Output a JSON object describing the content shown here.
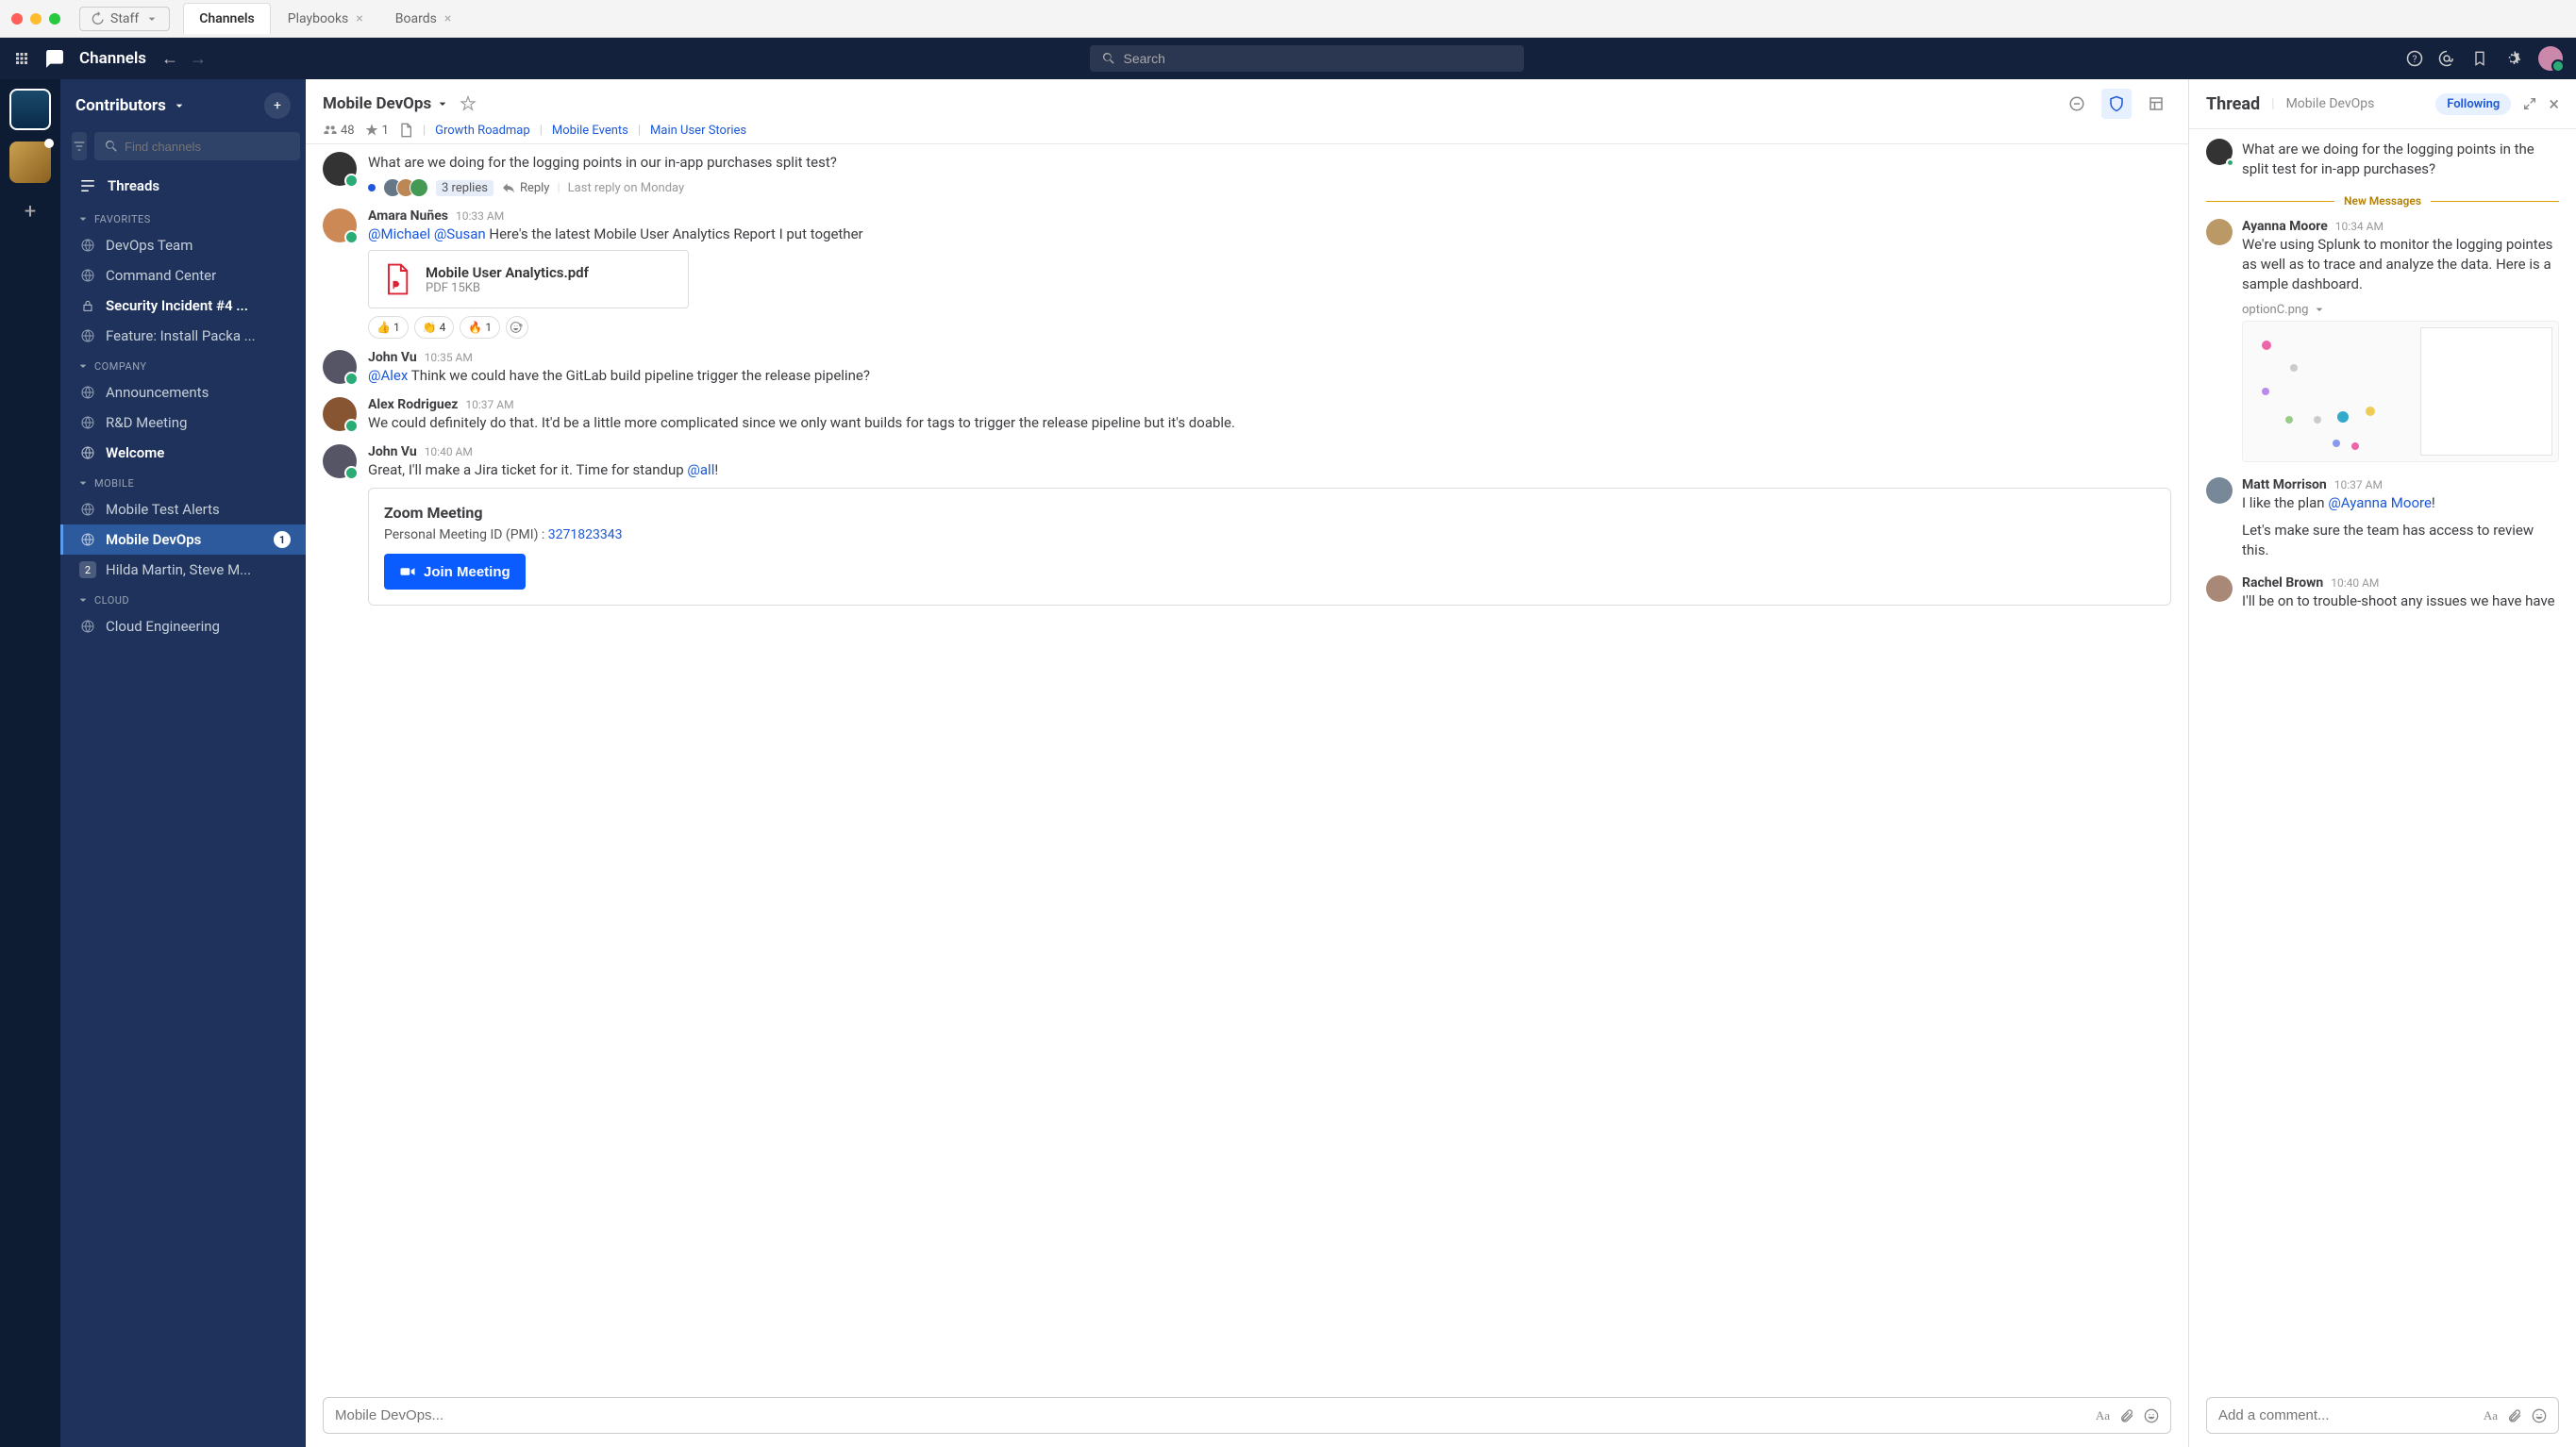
{
  "titlebar": {
    "staff_label": "Staff",
    "tabs": [
      {
        "label": "Channels",
        "active": true,
        "closable": false
      },
      {
        "label": "Playbooks",
        "active": false,
        "closable": true
      },
      {
        "label": "Boards",
        "active": false,
        "closable": true
      }
    ]
  },
  "topbar": {
    "channels_label": "Channels",
    "search_placeholder": "Search"
  },
  "workspace": {
    "name": "Contributors",
    "find_placeholder": "Find channels",
    "threads_label": "Threads"
  },
  "sidebar_sections": [
    {
      "title": "FAVORITES",
      "items": [
        {
          "icon": "globe",
          "label": "DevOps Team",
          "bold": false
        },
        {
          "icon": "globe",
          "label": "Command Center",
          "bold": false
        },
        {
          "icon": "lock",
          "label": "Security Incident #4 ...",
          "bold": true
        },
        {
          "icon": "globe",
          "label": "Feature: Install Packa ...",
          "bold": false
        }
      ]
    },
    {
      "title": "COMPANY",
      "items": [
        {
          "icon": "globe",
          "label": "Announcements",
          "bold": false
        },
        {
          "icon": "globe",
          "label": "R&D Meeting",
          "bold": false
        },
        {
          "icon": "globe",
          "label": "Welcome",
          "bold": true
        }
      ]
    },
    {
      "title": "MOBILE",
      "items": [
        {
          "icon": "globe",
          "label": "Mobile Test Alerts",
          "bold": false
        },
        {
          "icon": "globe",
          "label": "Mobile DevOps",
          "bold": true,
          "active": true,
          "badge": "1"
        },
        {
          "icon": "dm",
          "label": "Hilda Martin, Steve M...",
          "bold": false,
          "dm_count": "2"
        }
      ]
    },
    {
      "title": "CLOUD",
      "items": [
        {
          "icon": "globe",
          "label": "Cloud Engineering",
          "bold": false
        }
      ]
    }
  ],
  "channel": {
    "name": "Mobile DevOps",
    "members": "48",
    "pinned": "1",
    "header_links": [
      "Growth Roadmap",
      "Mobile Events",
      "Main User Stories"
    ]
  },
  "messages": {
    "truncated_q": "What are we doing for the logging points in our in-app purchases split test?",
    "truncated_reply_count": "3 replies",
    "truncated_reply_label": "Reply",
    "truncated_last_reply": "Last reply on Monday",
    "m1": {
      "name": "Amara Nuñes",
      "time": "10:33 AM",
      "mention1": "@Michael",
      "mention2": "@Susan",
      "rest": " Here's the latest Mobile User Analytics Report I put together",
      "file_name": "Mobile User Analytics.pdf",
      "file_meta": "PDF 15KB",
      "reactions": [
        {
          "emoji": "👍",
          "count": "1"
        },
        {
          "emoji": "👏",
          "count": "4"
        },
        {
          "emoji": "🔥",
          "count": "1"
        }
      ]
    },
    "m2": {
      "name": "John Vu",
      "time": "10:35 AM",
      "mention": "@Alex",
      "rest": " Think we could have the GitLab build pipeline trigger the release pipeline?"
    },
    "m3": {
      "name": "Alex Rodriguez",
      "time": "10:37 AM",
      "text": "We could definitely do that. It'd be a little more complicated since we only want builds for tags to trigger the release pipeline but it's doable."
    },
    "m4": {
      "name": "John Vu",
      "time": "10:40 AM",
      "pre": "Great, I'll make a Jira ticket for it. Time for standup ",
      "mention": "@all",
      "post": "!",
      "zoom_title": "Zoom Meeting",
      "zoom_pmi_label": "Personal Meeting ID (PMI) : ",
      "zoom_pmi": "3271823343",
      "zoom_join": "Join Meeting"
    }
  },
  "composer": {
    "placeholder": "Mobile DevOps..."
  },
  "thread": {
    "title": "Thread",
    "subtitle": "Mobile DevOps",
    "following": "Following",
    "new_messages": "New Messages",
    "root_q": "What are we doing for the logging points in the split test for in-app purchases?",
    "t1": {
      "name": "Ayanna Moore",
      "time": "10:34 AM",
      "text": "We're using Splunk to monitor the logging pointes as well as to trace and analyze the data. Here is a sample dashboard.",
      "img_name": "optionC.png"
    },
    "t2": {
      "name": "Matt Morrison",
      "time": "10:37 AM",
      "pre": "I like the plan ",
      "mention": "@Ayanna Moore",
      "post": "!",
      "text2": "Let's make sure the team has access to review this."
    },
    "t3": {
      "name": "Rachel Brown",
      "time": "10:40 AM",
      "text": "I'll be on to trouble-shoot any issues we have have"
    },
    "composer_placeholder": "Add a comment..."
  }
}
